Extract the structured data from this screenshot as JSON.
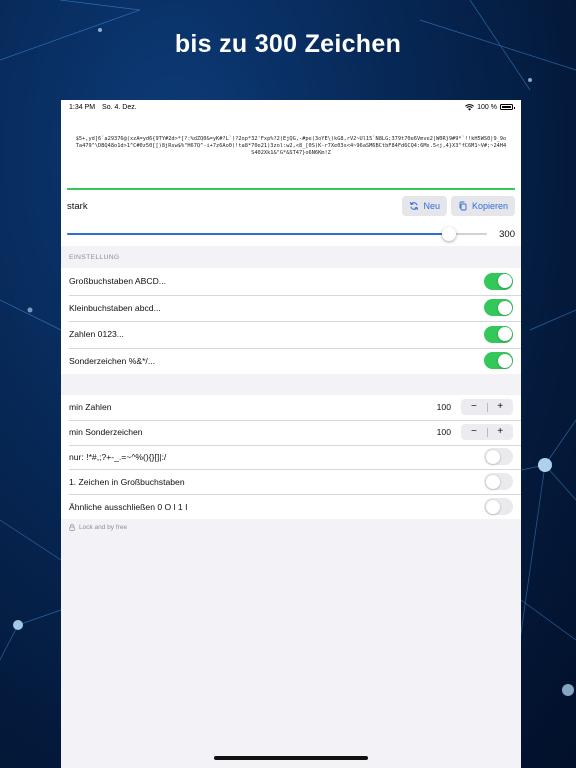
{
  "headline": "bis zu 300 Zeichen",
  "status_bar": {
    "time": "1:34 PM",
    "date": "So. 4. Dez.",
    "battery": "100 %"
  },
  "password": "$5+,yd]6`a29376@(xzA=yd6{9TY#2d>*[?:%dZQ0&=yK#?L`)?2op*32'Fxp%?2)EjQG,-#pe(3oYE\\)kG8,rV2~Ul15`N8LG;379t70e6Vmve2|W0R}9#9*`!!kH5WS0|9_9oTa479^\\DBQ48o1d>1^C#0z50[[)8jRsw$%\"H67Q^-i+7z6Ao0)!ta8*70e21)3zol:w2,<8_[0S)K-r7Xe03s<4~96aSM6BCtbF84Fd6CQ4:6Ms.5<j,4}X3\"fC6M1~V#;~24H4S402Xk1&\"G*&ST47}o6N6Km!Z",
  "strength_label": "stark",
  "buttons": {
    "new": "Neu",
    "copy": "Kopieren"
  },
  "length": {
    "value": "300",
    "fraction": 0.91
  },
  "settings": {
    "header": "EINSTELLUNG",
    "toggles": [
      {
        "label": "Großbuchstaben ABCD...",
        "on": true
      },
      {
        "label": "Kleinbuchstaben abcd...",
        "on": true
      },
      {
        "label": "Zahlen 0123...",
        "on": true
      },
      {
        "label": "Sonderzeichen %&*/...",
        "on": true
      }
    ]
  },
  "advanced": {
    "min_numbers": {
      "label": "min Zahlen",
      "value": "100"
    },
    "min_special": {
      "label": "min Sonderzeichen",
      "value": "100"
    },
    "stepper": {
      "minus": "−",
      "plus": "+"
    },
    "toggles": [
      {
        "label": "nur: !*#,;?+-_.=~^%(){}[]|:/",
        "on": false
      },
      {
        "label": "1. Zeichen in Großbuchstaben",
        "on": false
      },
      {
        "label": "Ähnliche ausschließen 0 O l 1 I",
        "on": false
      }
    ]
  },
  "footer": "Lock and by free",
  "colors": {
    "accent": "#2f6fd8",
    "toggle_on": "#34c759",
    "strength": "#34c759",
    "background": "#f2f2f7"
  },
  "icons": [
    "wifi-icon",
    "battery-icon",
    "refresh-icon",
    "copy-icon",
    "lock-icon"
  ]
}
